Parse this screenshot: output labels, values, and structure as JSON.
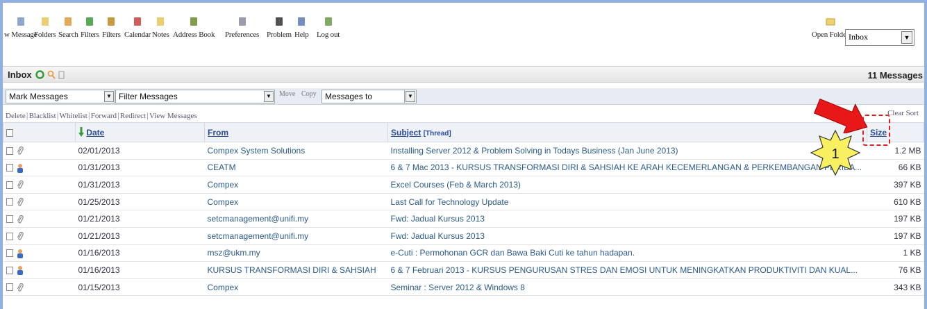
{
  "toolbar": {
    "items": [
      {
        "label": "w Message",
        "icon": "compose-icon",
        "color": "#7a96c8"
      },
      {
        "label": "Folders",
        "icon": "folder-icon",
        "color": "#e8c45a"
      },
      {
        "label": "Search",
        "icon": "search-icon",
        "color": "#e09a3a"
      },
      {
        "label": "Filters",
        "icon": "filter-icon",
        "color": "#3c9a3c"
      },
      {
        "label": "Filters",
        "icon": "pen-icon",
        "color": "#c08a20"
      },
      {
        "label": "Calendar",
        "icon": "calendar-icon",
        "color": "#c84040"
      },
      {
        "label": "Notes",
        "icon": "notes-icon",
        "color": "#e8c45a"
      },
      {
        "label": "Address Book",
        "icon": "address-book-icon",
        "color": "#6a8a2a"
      },
      {
        "label": "Preferences",
        "icon": "preferences-icon",
        "color": "#8a8aa0"
      },
      {
        "label": "Problem",
        "icon": "bomb-icon",
        "color": "#333333"
      },
      {
        "label": "Help",
        "icon": "help-icon",
        "color": "#5a7ab8"
      },
      {
        "label": "Log out",
        "icon": "logout-icon",
        "color": "#6a9a4a"
      }
    ],
    "open_folder_label": "Open Folder",
    "folder_select_value": "Inbox"
  },
  "inbox": {
    "title": "Inbox",
    "count": "11 Messages"
  },
  "filters": {
    "mark_messages": "Mark Messages",
    "filter_messages": "Filter Messages",
    "move_label": "Move",
    "copy_label": "Copy",
    "messages_to": "Messages to"
  },
  "actions": [
    "Delete",
    "Blacklist",
    "Whitelist",
    "Forward",
    "Redirect",
    "View Messages"
  ],
  "clear_sort": "Clear Sort",
  "table": {
    "headers": {
      "date": "Date",
      "from": "From",
      "subject": "Subject",
      "thread": "[Thread]",
      "size": "Size"
    },
    "rows": [
      {
        "icon": "paperclip-icon",
        "date": "02/01/2013",
        "from": "Compex System Solutions",
        "subject": "Installing Server 2012 & Problem Solving in Todays Business (Jan June 2013)",
        "size": "1.2 MB"
      },
      {
        "icon": "person-icon",
        "date": "01/31/2013",
        "from": "CEATM",
        "subject": "6 & 7 Mac 2013 - KURSUS TRANSFORMASI DIRI & SAHSIAH KE ARAH KECEMERLANGAN & PERKEMBANGAN PERIBA...",
        "size": "66 KB"
      },
      {
        "icon": "paperclip-icon",
        "date": "01/31/2013",
        "from": "Compex",
        "subject": "Excel Courses (Feb & March 2013)",
        "size": "397 KB"
      },
      {
        "icon": "paperclip-icon",
        "date": "01/25/2013",
        "from": "Compex",
        "subject": "Last Call for Technology Update",
        "size": "610 KB"
      },
      {
        "icon": "paperclip-icon",
        "date": "01/21/2013",
        "from": "setcmanagement@unifi.my",
        "subject": "Fwd: Jadual Kursus 2013",
        "size": "197 KB"
      },
      {
        "icon": "paperclip-icon",
        "date": "01/21/2013",
        "from": "setcmanagement@unifi.my",
        "subject": "Fwd: Jadual Kursus 2013",
        "size": "197 KB"
      },
      {
        "icon": "person-icon",
        "date": "01/16/2013",
        "from": "msz@ukm.my",
        "subject": "e-Cuti : Permohonan GCR dan Bawa Baki Cuti ke tahun hadapan.",
        "size": "1 KB"
      },
      {
        "icon": "person-icon",
        "date": "01/16/2013",
        "from": "KURSUS TRANSFORMASI DIRI & SAHSIAH",
        "subject": "6 & 7 Februari 2013 - KURSUS PENGURUSAN STRES DAN EMOSI UNTUK MENINGKATKAN PRODUKTIVITI DAN KUAL...",
        "size": "76 KB"
      },
      {
        "icon": "paperclip-icon",
        "date": "01/15/2013",
        "from": "Compex",
        "subject": "Seminar : Server 2012 & Windows 8",
        "size": "343 KB"
      }
    ]
  },
  "annotation": {
    "number": "1"
  }
}
